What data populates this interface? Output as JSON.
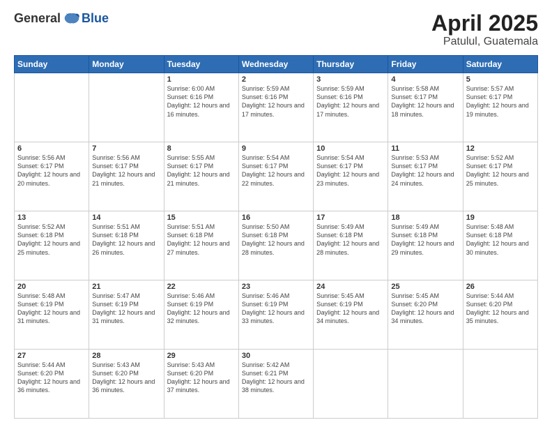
{
  "logo": {
    "general": "General",
    "blue": "Blue"
  },
  "title": {
    "month": "April 2025",
    "location": "Patulul, Guatemala"
  },
  "weekdays": [
    "Sunday",
    "Monday",
    "Tuesday",
    "Wednesday",
    "Thursday",
    "Friday",
    "Saturday"
  ],
  "weeks": [
    [
      {
        "day": "",
        "info": ""
      },
      {
        "day": "",
        "info": ""
      },
      {
        "day": "1",
        "info": "Sunrise: 6:00 AM\nSunset: 6:16 PM\nDaylight: 12 hours and 16 minutes."
      },
      {
        "day": "2",
        "info": "Sunrise: 5:59 AM\nSunset: 6:16 PM\nDaylight: 12 hours and 17 minutes."
      },
      {
        "day": "3",
        "info": "Sunrise: 5:59 AM\nSunset: 6:16 PM\nDaylight: 12 hours and 17 minutes."
      },
      {
        "day": "4",
        "info": "Sunrise: 5:58 AM\nSunset: 6:17 PM\nDaylight: 12 hours and 18 minutes."
      },
      {
        "day": "5",
        "info": "Sunrise: 5:57 AM\nSunset: 6:17 PM\nDaylight: 12 hours and 19 minutes."
      }
    ],
    [
      {
        "day": "6",
        "info": "Sunrise: 5:56 AM\nSunset: 6:17 PM\nDaylight: 12 hours and 20 minutes."
      },
      {
        "day": "7",
        "info": "Sunrise: 5:56 AM\nSunset: 6:17 PM\nDaylight: 12 hours and 21 minutes."
      },
      {
        "day": "8",
        "info": "Sunrise: 5:55 AM\nSunset: 6:17 PM\nDaylight: 12 hours and 21 minutes."
      },
      {
        "day": "9",
        "info": "Sunrise: 5:54 AM\nSunset: 6:17 PM\nDaylight: 12 hours and 22 minutes."
      },
      {
        "day": "10",
        "info": "Sunrise: 5:54 AM\nSunset: 6:17 PM\nDaylight: 12 hours and 23 minutes."
      },
      {
        "day": "11",
        "info": "Sunrise: 5:53 AM\nSunset: 6:17 PM\nDaylight: 12 hours and 24 minutes."
      },
      {
        "day": "12",
        "info": "Sunrise: 5:52 AM\nSunset: 6:17 PM\nDaylight: 12 hours and 25 minutes."
      }
    ],
    [
      {
        "day": "13",
        "info": "Sunrise: 5:52 AM\nSunset: 6:18 PM\nDaylight: 12 hours and 25 minutes."
      },
      {
        "day": "14",
        "info": "Sunrise: 5:51 AM\nSunset: 6:18 PM\nDaylight: 12 hours and 26 minutes."
      },
      {
        "day": "15",
        "info": "Sunrise: 5:51 AM\nSunset: 6:18 PM\nDaylight: 12 hours and 27 minutes."
      },
      {
        "day": "16",
        "info": "Sunrise: 5:50 AM\nSunset: 6:18 PM\nDaylight: 12 hours and 28 minutes."
      },
      {
        "day": "17",
        "info": "Sunrise: 5:49 AM\nSunset: 6:18 PM\nDaylight: 12 hours and 28 minutes."
      },
      {
        "day": "18",
        "info": "Sunrise: 5:49 AM\nSunset: 6:18 PM\nDaylight: 12 hours and 29 minutes."
      },
      {
        "day": "19",
        "info": "Sunrise: 5:48 AM\nSunset: 6:18 PM\nDaylight: 12 hours and 30 minutes."
      }
    ],
    [
      {
        "day": "20",
        "info": "Sunrise: 5:48 AM\nSunset: 6:19 PM\nDaylight: 12 hours and 31 minutes."
      },
      {
        "day": "21",
        "info": "Sunrise: 5:47 AM\nSunset: 6:19 PM\nDaylight: 12 hours and 31 minutes."
      },
      {
        "day": "22",
        "info": "Sunrise: 5:46 AM\nSunset: 6:19 PM\nDaylight: 12 hours and 32 minutes."
      },
      {
        "day": "23",
        "info": "Sunrise: 5:46 AM\nSunset: 6:19 PM\nDaylight: 12 hours and 33 minutes."
      },
      {
        "day": "24",
        "info": "Sunrise: 5:45 AM\nSunset: 6:19 PM\nDaylight: 12 hours and 34 minutes."
      },
      {
        "day": "25",
        "info": "Sunrise: 5:45 AM\nSunset: 6:20 PM\nDaylight: 12 hours and 34 minutes."
      },
      {
        "day": "26",
        "info": "Sunrise: 5:44 AM\nSunset: 6:20 PM\nDaylight: 12 hours and 35 minutes."
      }
    ],
    [
      {
        "day": "27",
        "info": "Sunrise: 5:44 AM\nSunset: 6:20 PM\nDaylight: 12 hours and 36 minutes."
      },
      {
        "day": "28",
        "info": "Sunrise: 5:43 AM\nSunset: 6:20 PM\nDaylight: 12 hours and 36 minutes."
      },
      {
        "day": "29",
        "info": "Sunrise: 5:43 AM\nSunset: 6:20 PM\nDaylight: 12 hours and 37 minutes."
      },
      {
        "day": "30",
        "info": "Sunrise: 5:42 AM\nSunset: 6:21 PM\nDaylight: 12 hours and 38 minutes."
      },
      {
        "day": "",
        "info": ""
      },
      {
        "day": "",
        "info": ""
      },
      {
        "day": "",
        "info": ""
      }
    ]
  ]
}
